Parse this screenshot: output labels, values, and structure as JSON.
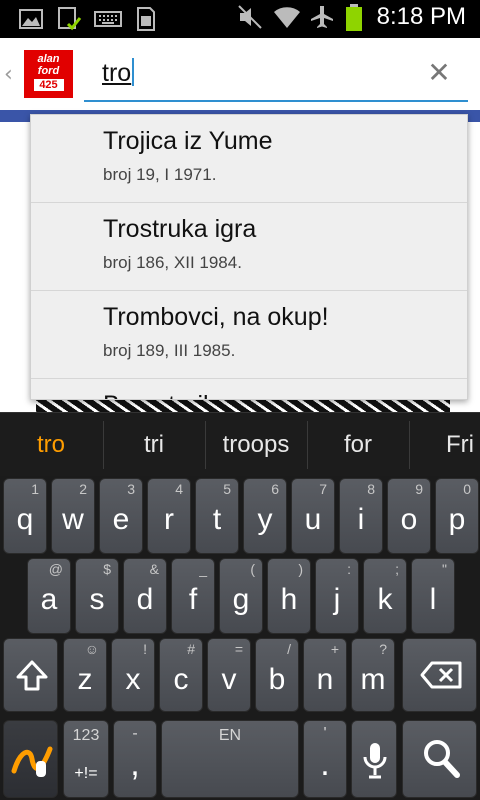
{
  "status_bar": {
    "time": "8:18 PM",
    "icons": [
      "image-icon",
      "download-check-icon",
      "keyboard-icon",
      "sim-card-icon",
      "mute-icon",
      "wifi-icon",
      "airplane-mode-icon",
      "battery-icon"
    ],
    "battery_color": "#8fd400"
  },
  "app": {
    "back_glyph": "‹",
    "logo_lines": [
      "alan",
      "ford",
      "425"
    ],
    "search": {
      "value_prefix": "tro",
      "placeholder": ""
    },
    "clear_glyph": "✕",
    "accent_color": "#3a55a8"
  },
  "dropdown": {
    "items": [
      {
        "title": "Trojica iz Yume",
        "subtitle": "broj 19, I 1971."
      },
      {
        "title": "Trostruka igra",
        "subtitle": "broj 186, XII 1984."
      },
      {
        "title": "Trombovci, na okup!",
        "subtitle": "broj 189, III 1985."
      },
      {
        "title": "Barostraike",
        "subtitle": ""
      }
    ]
  },
  "suggestions": {
    "items": [
      "tro",
      "tri",
      "troops",
      "for",
      "Fri"
    ],
    "highlight_color": "#ff9d00"
  },
  "keyboard": {
    "row1": [
      {
        "k": "q",
        "h": "1"
      },
      {
        "k": "w",
        "h": "2"
      },
      {
        "k": "e",
        "h": "3"
      },
      {
        "k": "r",
        "h": "4"
      },
      {
        "k": "t",
        "h": "5"
      },
      {
        "k": "y",
        "h": "6"
      },
      {
        "k": "u",
        "h": "7"
      },
      {
        "k": "i",
        "h": "8"
      },
      {
        "k": "o",
        "h": "9"
      },
      {
        "k": "p",
        "h": "0"
      }
    ],
    "row2": [
      {
        "k": "a",
        "h": "@"
      },
      {
        "k": "s",
        "h": "$"
      },
      {
        "k": "d",
        "h": "&"
      },
      {
        "k": "f",
        "h": "_"
      },
      {
        "k": "g",
        "h": "("
      },
      {
        "k": "h",
        "h": ")"
      },
      {
        "k": "j",
        "h": ":"
      },
      {
        "k": "k",
        "h": ";"
      },
      {
        "k": "l",
        "h": "\""
      }
    ],
    "row3": [
      {
        "k": "z",
        "h": "☺"
      },
      {
        "k": "x",
        "h": "!"
      },
      {
        "k": "c",
        "h": "#"
      },
      {
        "k": "v",
        "h": "="
      },
      {
        "k": "b",
        "h": "/"
      },
      {
        "k": "n",
        "h": "+"
      },
      {
        "k": "m",
        "h": "?"
      }
    ],
    "sym_top": "123",
    "sym_bottom": "+!=",
    "comma": ",",
    "comma_hint": "-",
    "space_label": "EN",
    "period": ".",
    "period_hint": "'"
  }
}
